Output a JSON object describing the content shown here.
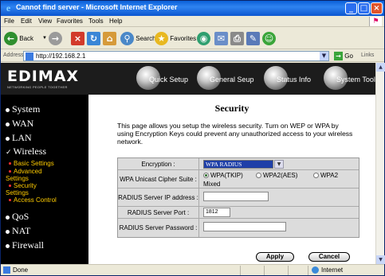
{
  "window": {
    "title": "Cannot find server - Microsoft Internet Explorer",
    "min_glyph": "_",
    "max_glyph": "□",
    "close_glyph": "×"
  },
  "menu": [
    "File",
    "Edit",
    "View",
    "Favorites",
    "Tools",
    "Help"
  ],
  "toolbar": {
    "back": "Back",
    "search": "Search",
    "favorites": "Favorites"
  },
  "address": {
    "label": "Address",
    "url": "http://192.168.2.1",
    "go": "Go",
    "links": "Links"
  },
  "router": {
    "logo": "EDIMAX",
    "logo_sub": "NETWORKING PEOPLE TOGETHER",
    "nav": [
      "Quick Setup",
      "General Seup",
      "Status Info",
      "System Tools"
    ]
  },
  "sidebar": {
    "items": [
      "System",
      "WAN",
      "LAN",
      "Wireless"
    ],
    "wireless_sub": [
      {
        "line1": "Basic Settings"
      },
      {
        "line1": "Advanced",
        "line2": "Settings"
      },
      {
        "line1": "Security",
        "line2": "Settings"
      },
      {
        "line1": "Access Control"
      }
    ],
    "items_after": [
      "QoS",
      "NAT",
      "Firewall"
    ]
  },
  "security": {
    "title": "Security",
    "description": "This page allows you setup the wireless security. Turn on WEP or WPA by using Encryption Keys could prevent any unauthorized access to your wireless network.",
    "encryption_label": "Encryption :",
    "encryption_value": "WPA RADIUS",
    "cipher_label": "WPA Unicast Cipher Suite :",
    "cipher_options": [
      "WPA(TKIP)",
      "WPA2(AES)",
      "WPA2"
    ],
    "cipher_selected": "WPA(TKIP)",
    "cipher_mixed": "Mixed",
    "radius_ip_label": "RADIUS Server IP address :",
    "radius_ip_value": "",
    "radius_port_label": "RADIUS Server Port :",
    "radius_port_value": "1812",
    "radius_password_label": "RADIUS Server Password :",
    "radius_password_value": "",
    "apply": "Apply",
    "cancel": "Cancel"
  },
  "status": {
    "left": "Done",
    "zone": "Internet"
  }
}
